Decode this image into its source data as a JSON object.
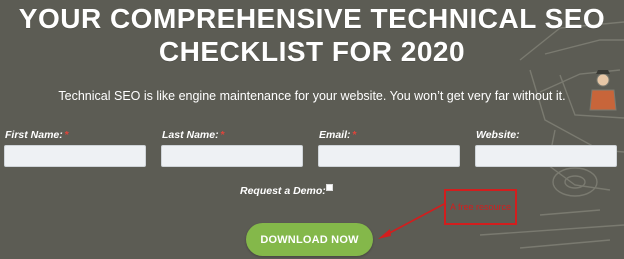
{
  "hero": {
    "title_line1": "YOUR COMPREHENSIVE TECHNICAL SEO",
    "title_line2": "CHECKLIST FOR 2020",
    "subtitle": "Technical SEO is like engine maintenance for your website. You won’t get very far without it."
  },
  "form": {
    "fields": [
      {
        "label": "First Name:",
        "required": "*",
        "value": ""
      },
      {
        "label": "Last Name:",
        "required": "*",
        "value": ""
      },
      {
        "label": "Email:",
        "required": "*",
        "value": ""
      },
      {
        "label": "Website:",
        "required": "",
        "value": ""
      }
    ],
    "demo_label": "Request a Demo:",
    "demo_checked": false,
    "submit_label": "DOWNLOAD NOW"
  },
  "annotation": {
    "text": "A free resource",
    "color": "#d21e1e"
  },
  "colors": {
    "background": "#5c5c54",
    "button": "#84b84a",
    "required": "#e0443a"
  }
}
